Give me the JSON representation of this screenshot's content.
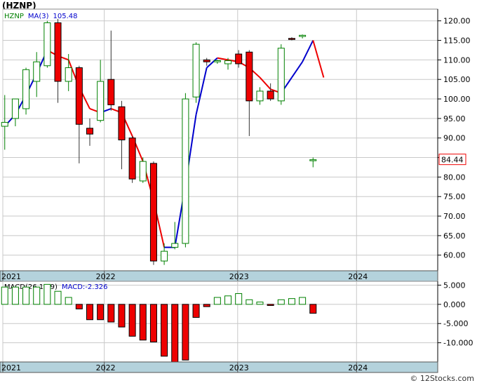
{
  "title": "(HZNP)",
  "footer": "© 12Stocks.com",
  "chart_data": [
    {
      "type": "candlestick",
      "legend": [
        {
          "text": "HZNP",
          "color": "#008000"
        },
        {
          "text": "MA(3)",
          "color": "#0000cc"
        },
        {
          "text": "105.48",
          "color": "#0000cc"
        }
      ],
      "last_price_label": "84.44",
      "ylim": [
        56,
        123
      ],
      "yticks": [
        60,
        65,
        70,
        75,
        80,
        85,
        90,
        95,
        100,
        105,
        110,
        115,
        120
      ],
      "ytick_labels": [
        "60.00",
        "65.00",
        "70.00",
        "75.00",
        "80.00",
        "85.00",
        "90.00",
        "95.00",
        "100.00",
        "105.00",
        "110.00",
        "115.00",
        "120.00"
      ],
      "xlim": [
        0,
        45
      ],
      "xticks": [
        {
          "label": "2021",
          "x": 0
        },
        {
          "label": "2022",
          "x": 10.5
        },
        {
          "label": "2023",
          "x": 24.3
        },
        {
          "label": "2024",
          "x": 36.6
        }
      ],
      "candles": [
        {
          "open": 93.0,
          "high": 101.0,
          "low": 87.0,
          "close": 94.0
        },
        {
          "open": 95.0,
          "high": 99.5,
          "low": 93.0,
          "close": 100.0
        },
        {
          "open": 97.5,
          "high": 108.0,
          "low": 96.0,
          "close": 107.5
        },
        {
          "open": 104.5,
          "high": 112.0,
          "low": 100.5,
          "close": 109.5
        },
        {
          "open": 108.5,
          "high": 120.0,
          "low": 108.0,
          "close": 119.5
        },
        {
          "open": 119.5,
          "high": 120.5,
          "low": 99.0,
          "close": 104.5
        },
        {
          "open": 104.5,
          "high": 111.5,
          "low": 102.0,
          "close": 108.0
        },
        {
          "open": 108.0,
          "high": 108.5,
          "low": 83.5,
          "close": 93.5
        },
        {
          "open": 92.5,
          "high": 95.0,
          "low": 88.0,
          "close": 91.0
        },
        {
          "open": 94.5,
          "high": 110.0,
          "low": 94.0,
          "close": 104.5
        },
        {
          "open": 105.0,
          "high": 117.5,
          "low": 97.0,
          "close": 98.5
        },
        {
          "open": 98.0,
          "high": 99.5,
          "low": 82.0,
          "close": 89.5
        },
        {
          "open": 90.0,
          "high": 90.5,
          "low": 78.5,
          "close": 79.5
        },
        {
          "open": 79.0,
          "high": 85.0,
          "low": 78.5,
          "close": 84.0
        },
        {
          "open": 83.5,
          "high": 84.0,
          "low": 57.5,
          "close": 58.5
        },
        {
          "open": 58.5,
          "high": 63.0,
          "low": 57.5,
          "close": 61.0
        },
        {
          "open": 62.0,
          "high": 68.5,
          "low": 61.5,
          "close": 63.0
        },
        {
          "open": 63.0,
          "high": 101.5,
          "low": 62.0,
          "close": 100.0
        },
        {
          "open": 100.5,
          "high": 114.5,
          "low": 99.0,
          "close": 114.0
        },
        {
          "open": 110.0,
          "high": 110.5,
          "low": 108.5,
          "close": 109.5
        },
        {
          "open": 109.5,
          "high": 110.0,
          "low": 109.0,
          "close": 109.8
        },
        {
          "open": 109.0,
          "high": 110.5,
          "low": 107.5,
          "close": 109.8
        },
        {
          "open": 111.5,
          "high": 112.5,
          "low": 108.0,
          "close": 109.0
        },
        {
          "open": 112.0,
          "high": 112.5,
          "low": 90.5,
          "close": 99.5
        },
        {
          "open": 99.5,
          "high": 103.0,
          "low": 98.5,
          "close": 102.0
        },
        {
          "open": 102.0,
          "high": 104.0,
          "low": 99.5,
          "close": 100.0
        },
        {
          "open": 99.5,
          "high": 114.0,
          "low": 98.5,
          "close": 113.0
        },
        {
          "open": 115.5,
          "high": 115.8,
          "low": 115.0,
          "close": 115.3
        },
        {
          "open": 116.0,
          "high": 116.5,
          "low": 115.5,
          "close": 116.3
        },
        {
          "open": 84.44,
          "high": 85.0,
          "low": 82.5,
          "close": 84.44
        }
      ],
      "candle_x": [
        0.2,
        1.3,
        2.4,
        3.5,
        4.6,
        5.7,
        6.8,
        7.9,
        9.0,
        10.1,
        11.2,
        12.3,
        13.4,
        14.5,
        15.6,
        16.7,
        17.8,
        18.9,
        20.0,
        21.1,
        22.2,
        23.3,
        24.4,
        25.5,
        26.6,
        27.7,
        28.8,
        29.9,
        31.0,
        32.1
      ],
      "ma3": [
        {
          "x": 0.2,
          "y": 93.0
        },
        {
          "x": 1.3,
          "y": 96.0
        },
        {
          "x": 2.4,
          "y": 101.0
        },
        {
          "x": 3.5,
          "y": 106.5
        },
        {
          "x": 4.6,
          "y": 112.5
        },
        {
          "x": 5.7,
          "y": 111.0
        },
        {
          "x": 6.8,
          "y": 110.0
        },
        {
          "x": 7.9,
          "y": 103.0
        },
        {
          "x": 9.0,
          "y": 97.5
        },
        {
          "x": 10.1,
          "y": 96.5
        },
        {
          "x": 11.2,
          "y": 97.5
        },
        {
          "x": 12.3,
          "y": 96.5
        },
        {
          "x": 13.4,
          "y": 90.5
        },
        {
          "x": 14.5,
          "y": 84.0
        },
        {
          "x": 15.6,
          "y": 74.0
        },
        {
          "x": 16.7,
          "y": 62.0
        },
        {
          "x": 17.8,
          "y": 62.0
        },
        {
          "x": 18.9,
          "y": 78.0
        },
        {
          "x": 20.0,
          "y": 96.0
        },
        {
          "x": 21.1,
          "y": 108.0
        },
        {
          "x": 22.2,
          "y": 110.5
        },
        {
          "x": 23.3,
          "y": 110.0
        },
        {
          "x": 24.4,
          "y": 109.5
        },
        {
          "x": 25.5,
          "y": 108.0
        },
        {
          "x": 26.6,
          "y": 105.5
        },
        {
          "x": 27.7,
          "y": 102.5
        },
        {
          "x": 28.8,
          "y": 101.5
        },
        {
          "x": 29.9,
          "y": 105.5
        },
        {
          "x": 31.0,
          "y": 109.5
        },
        {
          "x": 32.1,
          "y": 115.0
        },
        {
          "x": 33.2,
          "y": 105.48
        }
      ]
    },
    {
      "type": "bar",
      "legend": [
        {
          "text": "MACD(26,12,9)",
          "color": "#000000"
        },
        {
          "text": "MACD:-2.326",
          "color": "#0000cc"
        }
      ],
      "ylim": [
        -15,
        6
      ],
      "yticks": [
        5,
        0,
        -5,
        -10
      ],
      "ytick_labels": [
        "5.000",
        "0.000",
        "-5.000",
        "-10.000"
      ],
      "xticks": [
        {
          "label": "2021",
          "x": 0
        },
        {
          "label": "2022",
          "x": 10.5
        },
        {
          "label": "2023",
          "x": 24.3
        },
        {
          "label": "2024",
          "x": 36.6
        }
      ],
      "x": [
        0.2,
        1.3,
        2.4,
        3.5,
        4.6,
        5.7,
        6.8,
        7.9,
        9.0,
        10.1,
        11.2,
        12.3,
        13.4,
        14.5,
        15.6,
        16.7,
        17.8,
        18.9,
        20.0,
        21.1,
        22.2,
        23.3,
        24.4,
        25.5,
        26.6,
        27.7,
        28.8,
        29.9,
        31.0,
        32.1
      ],
      "values": [
        4.5,
        4.5,
        4.5,
        4.5,
        5.2,
        3.4,
        1.8,
        -1.2,
        -4.0,
        -4.0,
        -4.6,
        -5.9,
        -8.3,
        -9.3,
        -9.8,
        -13.5,
        -15.0,
        -14.5,
        -3.4,
        -0.6,
        1.8,
        2.2,
        2.8,
        1.2,
        0.6,
        -0.3,
        1.2,
        1.5,
        1.8,
        -2.33
      ],
      "colors": [
        "#ffffff",
        "#ffffff",
        "#ffffff",
        "#ffffff",
        "#ffffff",
        "#ffffff",
        "#ffffff",
        "#ee0000",
        "#ee0000",
        "#ee0000",
        "#ee0000",
        "#ee0000",
        "#ee0000",
        "#ee0000",
        "#ee0000",
        "#ee0000",
        "#ee0000",
        "#ee0000",
        "#ee0000",
        "#ee0000",
        "#ffffff",
        "#ffffff",
        "#ffffff",
        "#ffffff",
        "#ffffff",
        "#ee0000",
        "#ffffff",
        "#ffffff",
        "#ffffff",
        "#ee0000"
      ]
    }
  ],
  "colors": {
    "up_fill": "#ffffff",
    "up_stroke": "#008000",
    "down_fill": "#ee0000",
    "ma_up": "#0000cc",
    "ma_down": "#ee0000",
    "grid": "#c8c8c8",
    "axis_band": "#b4d2dc",
    "last_price_border": "#ee0000"
  }
}
